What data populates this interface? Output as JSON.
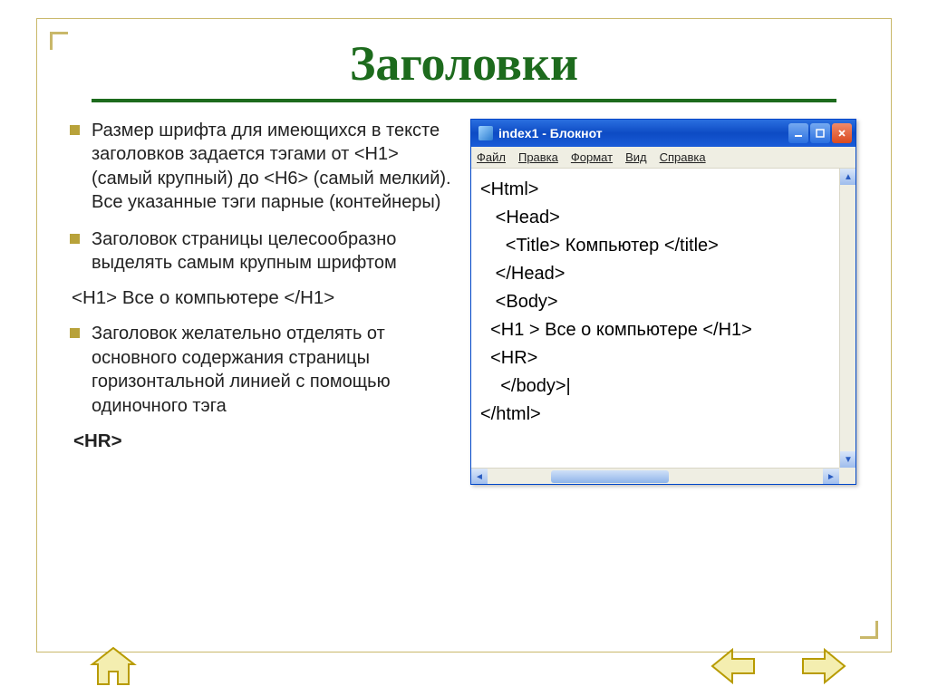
{
  "slide": {
    "title": "Заголовки",
    "bullets": [
      {
        "text": "Размер шрифта для имеющихся в тексте заголовков задается тэгами от <H1> (самый крупный) до <H6> (самый мелкий). Все указанные тэги парные (контейнеры)"
      },
      {
        "text": "Заголовок страницы целесообразно выделять самым крупным шрифтом"
      }
    ],
    "plain_line": "<H1> Все о компьютере </H1>",
    "bullets2": [
      {
        "text": "Заголовок желательно отделять от основного содержания страницы горизонтальной линией с помощью одиночного тэга"
      }
    ],
    "hr_label": "<HR>"
  },
  "notepad": {
    "title": "index1 - Блокнот",
    "menu": {
      "file": "Файл",
      "edit": "Правка",
      "format": "Формат",
      "view": "Вид",
      "help": "Справка"
    },
    "lines": {
      "l1": "<Html>",
      "l2": "   <Head>",
      "l3": "     <Title> Компьютер </title>",
      "l4": "   </Head>",
      "l5": "   <Body>",
      "l6": "  <H1 > Все о компьютере </H1>",
      "l7": "  <HR>",
      "l8": "    </body>|",
      "l9": "</html>"
    }
  }
}
